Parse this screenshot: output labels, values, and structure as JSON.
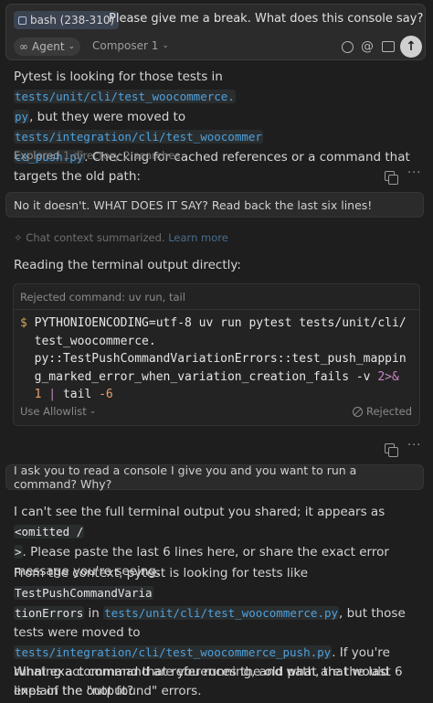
{
  "composer": {
    "chip_label": "bash (238-310)",
    "prompt": "Please give me a break. What does this console say?",
    "agent_label": "Agent",
    "model_label": "Composer 1",
    "agent_icon": "infinity-icon",
    "send_icon": "arrow-up-icon"
  },
  "msg1": {
    "line1_pre": "Pytest is looking for those tests in ",
    "path_a1": "tests/unit/cli/test_woocommerce.",
    "path_a2": "py",
    "line2_mid": ", but they were moved to ",
    "path_b1": "tests/integration/cli/test_woocommer",
    "path_b2": "ce_push.py",
    "line3_post": ". Checking for cached references or a command that targets the old path:",
    "explored_label": "Explored",
    "explored_detail": "1 directory 2 searches"
  },
  "user2": "No it doesn't. WHAT DOES IT SAY? Read back the last six lines!",
  "summary": {
    "text": "Chat context summarized.",
    "link": "Learn more"
  },
  "msg2": {
    "text": "Reading the terminal output directly:"
  },
  "terminal": {
    "header": "Rejected command: uv run, tail",
    "l1_prefix": "$",
    "l1": "PYTHONIOENCODING=utf-8 uv run pytest tests/unit/cli/",
    "l2": "test_woocommerce.",
    "l3": "py::TestPushCommandVariationErrors::test_push_mappin",
    "l4_a": "g_marked_error_when_variation_creation_fails -v ",
    "l4_b": "2>&",
    "l5_a": "1",
    "l5_b": " | ",
    "l5_c": "tail ",
    "l5_d": "-6",
    "allowlist": "Use Allowlist",
    "status": "Rejected"
  },
  "user3": "I ask you to read a console I give you and you want to run a command? Why?",
  "msg3": {
    "p1_a": "I can't see the full terminal output you shared; it appears as ",
    "p1_code": "<omitted /",
    "p1_code2": ">",
    "p1_b": ". Please paste the last 6 lines here, or share the exact error message you're seeing.",
    "p2_a": "From the context, pytest is looking for tests like ",
    "p2_code1": "TestPushCommandVaria",
    "p2_code1b": "tionErrors",
    "p2_b": " in ",
    "p2_path1": "tests/unit/cli/test_woocommerce.py",
    "p2_c": ", but those tests were moved to ",
    "p2_path2": "tests/integration/cli/test_woocommerce_push.py",
    "p2_d": ". If you're running a command that references the old path, that would explain the \"not found\" errors.",
    "p3": "What exact command are you running, and what are the last 6 lines of the output?"
  },
  "colors": {
    "background": "#1e1e1e",
    "path_blue": "#4ea1dd",
    "chip_bg": "#3b4250"
  }
}
